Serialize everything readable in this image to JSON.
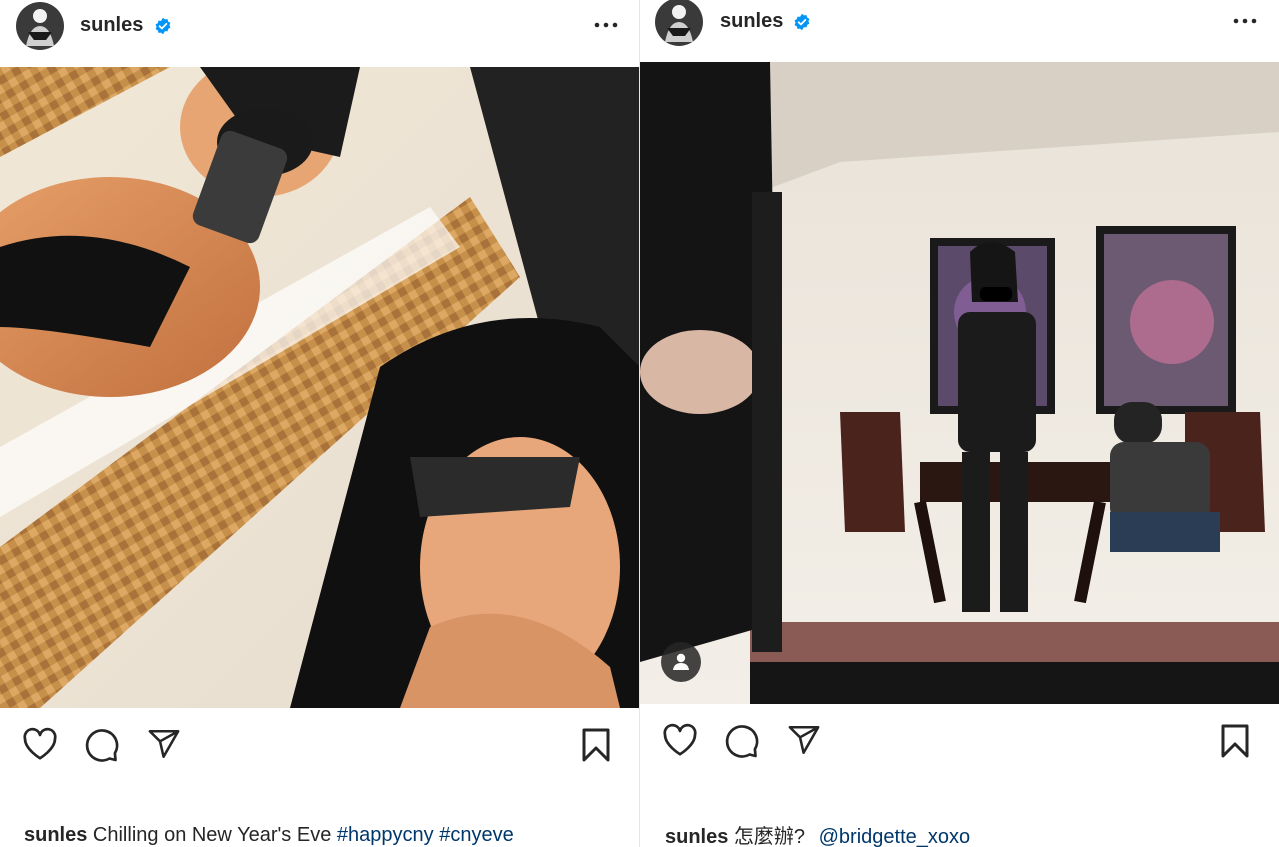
{
  "posts": [
    {
      "username": "sunles",
      "verified": true,
      "more_icon": "more-horizontal-icon",
      "caption": {
        "user": "sunles",
        "text": "Chilling on New Year's Eve",
        "hashtags": [
          "#happycny",
          "#cnyeve"
        ]
      }
    },
    {
      "username": "sunles",
      "verified": true,
      "more_icon": "more-horizontal-icon",
      "caption": {
        "user": "sunles",
        "text": "怎麼辦?",
        "mention": "@bridgette_xoxo"
      }
    }
  ],
  "colors": {
    "text": "#262626",
    "verified_blue": "#0095f6",
    "link": "#00376b"
  },
  "icons": [
    "heart-icon",
    "comment-icon",
    "share-icon",
    "bookmark-icon",
    "user-tag-icon",
    "verified-badge-icon"
  ]
}
